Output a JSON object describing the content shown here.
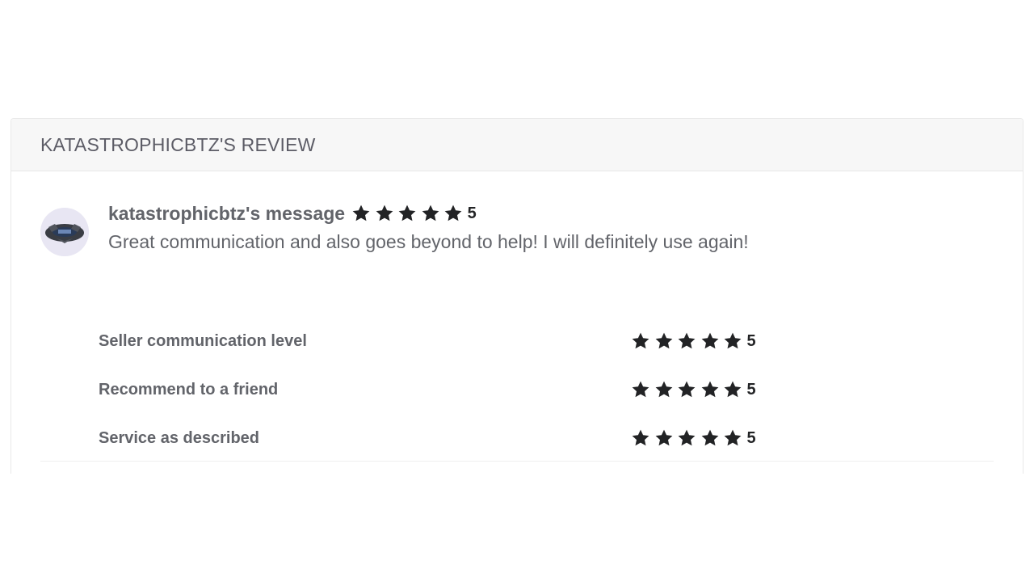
{
  "review_card": {
    "title": "KATASTROPHICBTZ'S REVIEW",
    "author_message_label": "katastrophicbtz's message",
    "overall_rating": 5,
    "overall_rating_text": "5",
    "comment": "Great communication and also goes beyond to help! I will definitely use again!",
    "criteria": [
      {
        "label": "Seller communication level",
        "rating": 5,
        "rating_text": "5"
      },
      {
        "label": "Recommend to a friend",
        "rating": 5,
        "rating_text": "5"
      },
      {
        "label": "Service as described",
        "rating": 5,
        "rating_text": "5"
      }
    ],
    "max_stars": 5,
    "star_color": "#222325",
    "text_color": "#62646a",
    "header_bg": "#f7f7f7",
    "icons": {
      "avatar": "user-avatar-icon",
      "star": "star-icon"
    }
  }
}
